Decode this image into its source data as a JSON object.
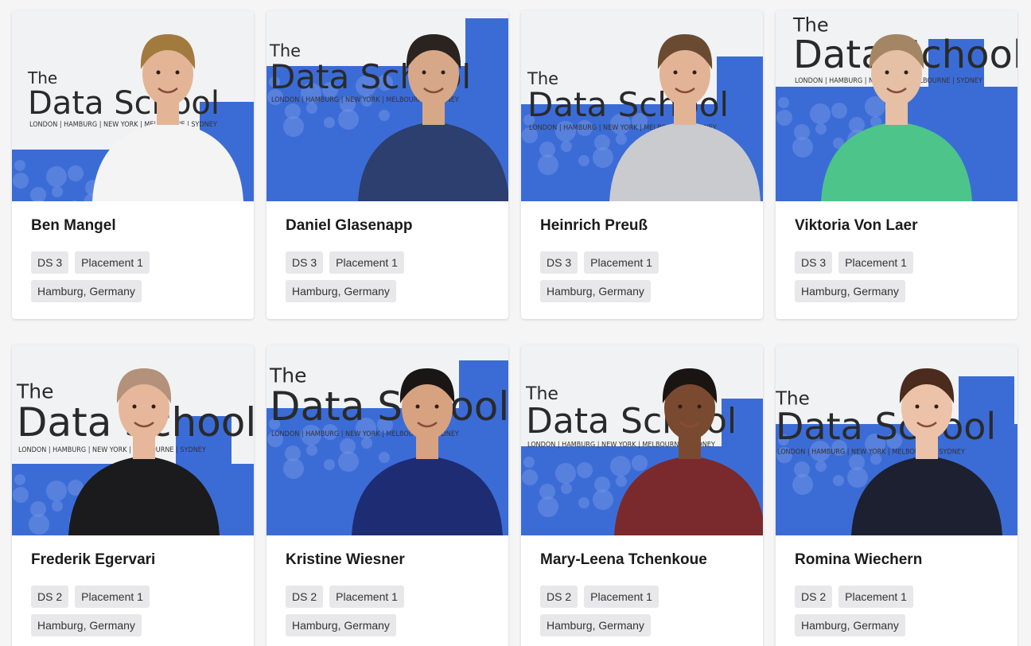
{
  "people": [
    {
      "name": "Ben Mangel",
      "cohort": "DS 3",
      "placement": "Placement 1",
      "location": "Hamburg, Germany",
      "banner": "The Data School",
      "shirt": "#f4f4f4",
      "hair": "#a27a3e",
      "skin": "#e3b596"
    },
    {
      "name": "Daniel Glasenapp",
      "cohort": "DS 3",
      "placement": "Placement 1",
      "location": "Hamburg, Germany",
      "banner": "The Data School",
      "shirt": "#2c3f6e",
      "hair": "#2b2320",
      "skin": "#d7a888"
    },
    {
      "name": "Heinrich Preuß",
      "cohort": "DS 3",
      "placement": "Placement 1",
      "location": "Hamburg, Germany",
      "banner": "The Data School",
      "shirt": "#c9cbcf",
      "hair": "#6a4b32",
      "skin": "#e2b495"
    },
    {
      "name": "Viktoria Von Laer",
      "cohort": "DS 3",
      "placement": "Placement 1",
      "location": "Hamburg, Germany",
      "banner": "The Data School",
      "shirt": "#4cc48a",
      "hair": "#a48664",
      "skin": "#e5c0a5"
    },
    {
      "name": "Frederik Egervari",
      "cohort": "DS 2",
      "placement": "Placement 1",
      "location": "Hamburg, Germany",
      "banner": "The Data School",
      "shirt": "#1b1b1d",
      "hair": "#b3917a",
      "skin": "#e6b79a"
    },
    {
      "name": "Kristine Wiesner",
      "cohort": "DS 2",
      "placement": "Placement 1",
      "location": "Hamburg, Germany",
      "banner": "The Data School",
      "shirt": "#1e2c73",
      "hair": "#1a1616",
      "skin": "#d7a27f"
    },
    {
      "name": "Mary-Leena Tchenkoue",
      "cohort": "DS 2",
      "placement": "Placement 1",
      "location": "Hamburg, Germany",
      "banner": "The Data School",
      "shirt": "#7a2a2c",
      "hair": "#1a1412",
      "skin": "#7a4a30"
    },
    {
      "name": "Romina Wiechern",
      "cohort": "DS 2",
      "placement": "Placement 1",
      "location": "Hamburg, Germany",
      "banner": "The Data School",
      "shirt": "#1c2030",
      "hair": "#4a2b1d",
      "skin": "#ecc3a8"
    }
  ],
  "banner_subtitle": "LONDON | HAMBURG | NEW YORK | MELBOURNE | SYDNEY",
  "colors": {
    "banner_blue": "#3b6cd6",
    "banner_white": "#f1f2f4"
  }
}
